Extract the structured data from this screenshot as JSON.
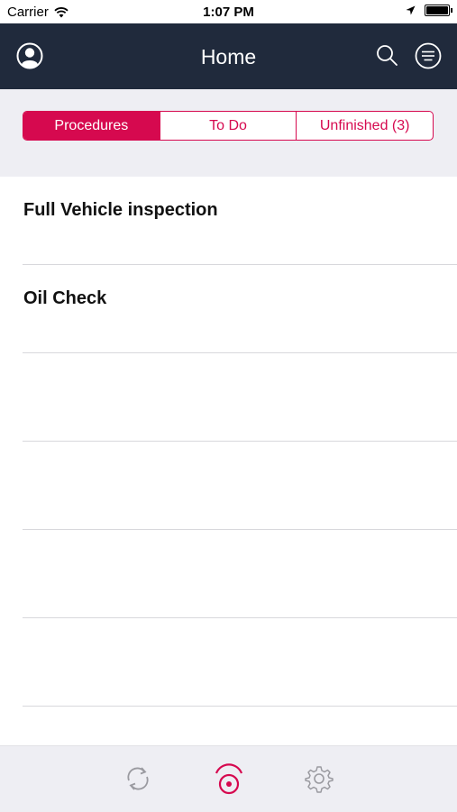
{
  "status_bar": {
    "carrier": "Carrier",
    "time": "1:07 PM",
    "wifi_icon": "wifi-icon",
    "location_icon": "location-arrow-icon",
    "battery_icon": "battery-icon"
  },
  "nav": {
    "title": "Home",
    "left_icon": "profile-icon",
    "right_icons": [
      "search-icon",
      "filter-menu-icon"
    ]
  },
  "segments": [
    {
      "label": "Procedures",
      "active": true
    },
    {
      "label": "To Do",
      "active": false
    },
    {
      "label": "Unfinished (3)",
      "active": false
    }
  ],
  "list_items": [
    {
      "label": "Full Vehicle inspection"
    },
    {
      "label": "Oil Check"
    },
    {
      "label": ""
    },
    {
      "label": ""
    },
    {
      "label": ""
    },
    {
      "label": ""
    }
  ],
  "tab_bar": {
    "items": [
      {
        "icon": "sync-icon",
        "active": false
      },
      {
        "icon": "broadcast-icon",
        "active": true
      },
      {
        "icon": "settings-gear-icon",
        "active": false
      }
    ]
  },
  "colors": {
    "accent": "#d6094f",
    "nav_background": "#202a3c",
    "inactive_icon": "#9a9aa0"
  }
}
